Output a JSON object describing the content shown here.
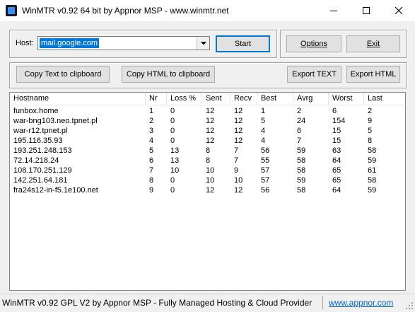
{
  "window": {
    "title": "WinMTR v0.92 64 bit by Appnor MSP - www.winmtr.net"
  },
  "host_panel": {
    "label": "Host:",
    "value": "mail.google.com",
    "start_label": "Start"
  },
  "side_panel": {
    "options_label": "Options",
    "exit_label": "Exit"
  },
  "export_panel": {
    "copy_text_label": "Copy Text to clipboard",
    "copy_html_label": "Copy HTML to clipboard",
    "export_text_label": "Export TEXT",
    "export_html_label": "Export HTML"
  },
  "table": {
    "columns": [
      "Hostname",
      "Nr",
      "Loss %",
      "Sent",
      "Recv",
      "Best",
      "Avrg",
      "Worst",
      "Last"
    ],
    "rows": [
      [
        "funbox.home",
        "1",
        "0",
        "12",
        "12",
        "1",
        "2",
        "6",
        "2"
      ],
      [
        "war-bng103.neo.tpnet.pl",
        "2",
        "0",
        "12",
        "12",
        "5",
        "24",
        "154",
        "9"
      ],
      [
        "war-r12.tpnet.pl",
        "3",
        "0",
        "12",
        "12",
        "4",
        "6",
        "15",
        "5"
      ],
      [
        "195.116.35.93",
        "4",
        "0",
        "12",
        "12",
        "4",
        "7",
        "15",
        "8"
      ],
      [
        "193.251.248.153",
        "5",
        "13",
        "8",
        "7",
        "56",
        "59",
        "63",
        "58"
      ],
      [
        "72.14.218.24",
        "6",
        "13",
        "8",
        "7",
        "55",
        "58",
        "64",
        "59"
      ],
      [
        "108.170.251.129",
        "7",
        "10",
        "10",
        "9",
        "57",
        "58",
        "65",
        "61"
      ],
      [
        "142.251.64.181",
        "8",
        "0",
        "10",
        "10",
        "57",
        "59",
        "65",
        "58"
      ],
      [
        "fra24s12-in-f5.1e100.net",
        "9",
        "0",
        "12",
        "12",
        "56",
        "58",
        "64",
        "59"
      ]
    ]
  },
  "status": {
    "text": "WinMTR v0.92 GPL V2 by Appnor MSP - Fully Managed Hosting & Cloud Provider",
    "link": "www.appnor.com"
  },
  "colors": {
    "selection": "#0078d7",
    "default_button_border": "#0078d7",
    "link": "#0066cc"
  },
  "icons": {
    "app": "winmtr-app-icon",
    "minimize": "minimize-icon",
    "maximize": "maximize-icon",
    "close": "close-icon",
    "dropdown": "chevron-down-icon",
    "grip": "resize-grip-icon"
  }
}
